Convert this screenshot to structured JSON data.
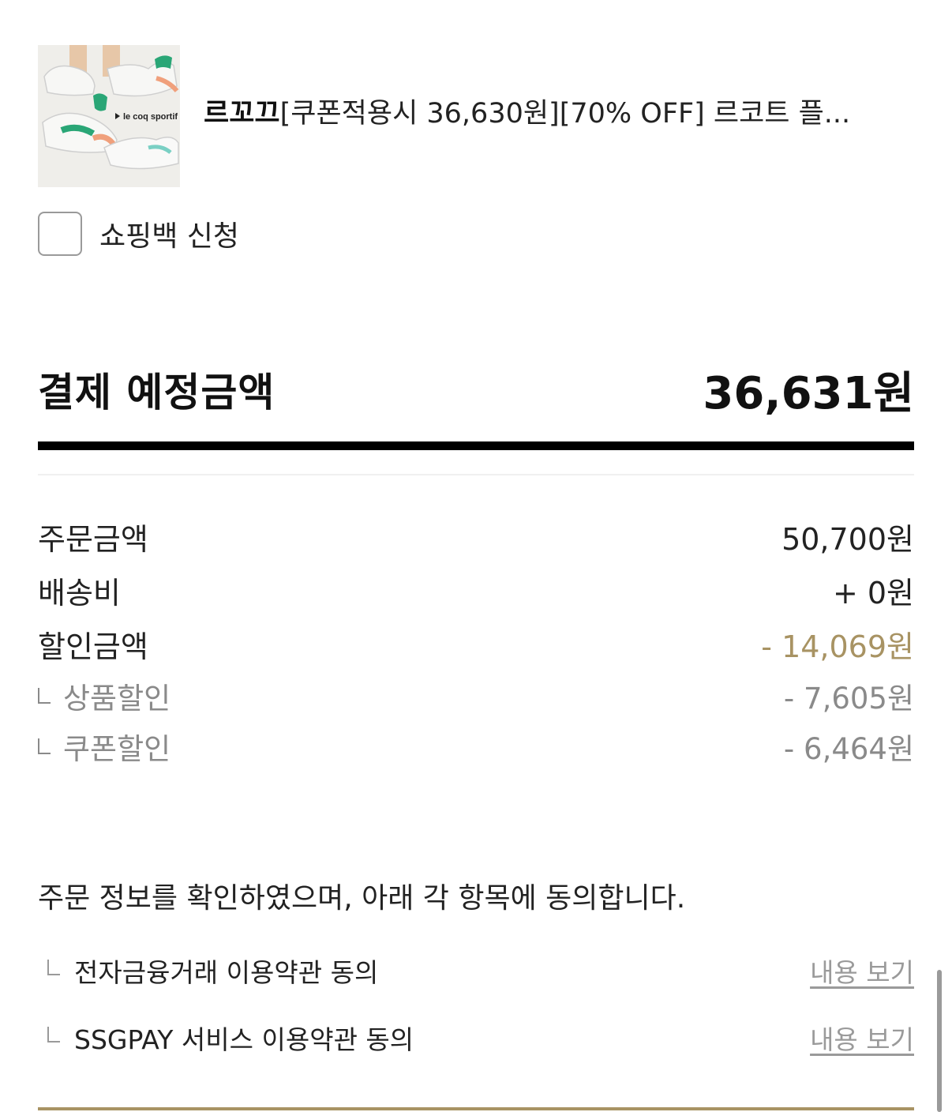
{
  "product": {
    "brand": "르꼬끄",
    "title": "[쿠폰적용시 36,630원][70% OFF] 르코트 플...",
    "thumbnail_logo_text": "le coq sportif"
  },
  "shopping_bag": {
    "label": "쇼핑백 신청",
    "checked": false
  },
  "total": {
    "label": "결제 예정금액",
    "value": "36,631원"
  },
  "breakdown": {
    "order": {
      "label": "주문금액",
      "value": "50,700원"
    },
    "shipping": {
      "label": "배송비",
      "value": "+ 0원"
    },
    "discount": {
      "label": "할인금액",
      "value": "- 14,069원"
    },
    "product_discount": {
      "label": "상품할인",
      "value": "- 7,605원"
    },
    "coupon_discount": {
      "label": "쿠폰할인",
      "value": "- 6,464원"
    }
  },
  "agreement": {
    "heading": "주문 정보를 확인하였으며, 아래 각 항목에 동의합니다.",
    "items": [
      {
        "label": "전자금융거래 이용약관 동의",
        "link": "내용 보기"
      },
      {
        "label": "SSGPAY 서비스 이용약관 동의",
        "link": "내용 보기"
      }
    ]
  },
  "colors": {
    "accent_gold": "#a89363",
    "text": "#222222",
    "muted": "#8a8a8a"
  }
}
